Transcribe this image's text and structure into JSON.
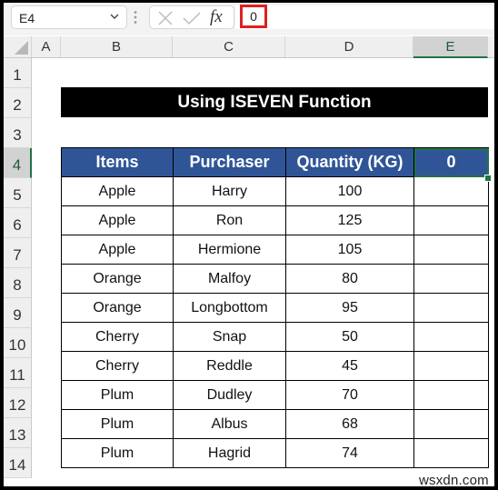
{
  "formula_bar": {
    "name_box": "E4",
    "cancel_icon": "x-icon",
    "enter_icon": "check-icon",
    "fx_label": "fx",
    "value": "0"
  },
  "columns": [
    "A",
    "B",
    "C",
    "D",
    "E"
  ],
  "selected_column": "E",
  "rows": [
    "1",
    "2",
    "3",
    "4",
    "5",
    "6",
    "7",
    "8",
    "9",
    "10",
    "11",
    "12",
    "13",
    "14"
  ],
  "selected_row": "4",
  "sheet": {
    "title": "Using ISEVEN Function",
    "headers": [
      "Items",
      "Purchaser",
      "Quantity (KG)",
      "0"
    ],
    "data": [
      {
        "item": "Apple",
        "purchaser": "Harry",
        "qty": "100",
        "result": ""
      },
      {
        "item": "Apple",
        "purchaser": "Ron",
        "qty": "125",
        "result": ""
      },
      {
        "item": "Apple",
        "purchaser": "Hermione",
        "qty": "105",
        "result": ""
      },
      {
        "item": "Orange",
        "purchaser": "Malfoy",
        "qty": "80",
        "result": ""
      },
      {
        "item": "Orange",
        "purchaser": "Longbottom",
        "qty": "95",
        "result": ""
      },
      {
        "item": "Cherry",
        "purchaser": "Snap",
        "qty": "50",
        "result": ""
      },
      {
        "item": "Cherry",
        "purchaser": "Reddle",
        "qty": "45",
        "result": ""
      },
      {
        "item": "Plum",
        "purchaser": "Dudley",
        "qty": "70",
        "result": ""
      },
      {
        "item": "Plum",
        "purchaser": "Albus",
        "qty": "68",
        "result": ""
      },
      {
        "item": "Plum",
        "purchaser": "Hagrid",
        "qty": "74",
        "result": ""
      }
    ]
  },
  "watermark": "wsxdn.com",
  "colors": {
    "header_fill": "#2f5597",
    "title_fill": "#000000",
    "selection": "#217346",
    "highlight_box": "#e02020"
  }
}
